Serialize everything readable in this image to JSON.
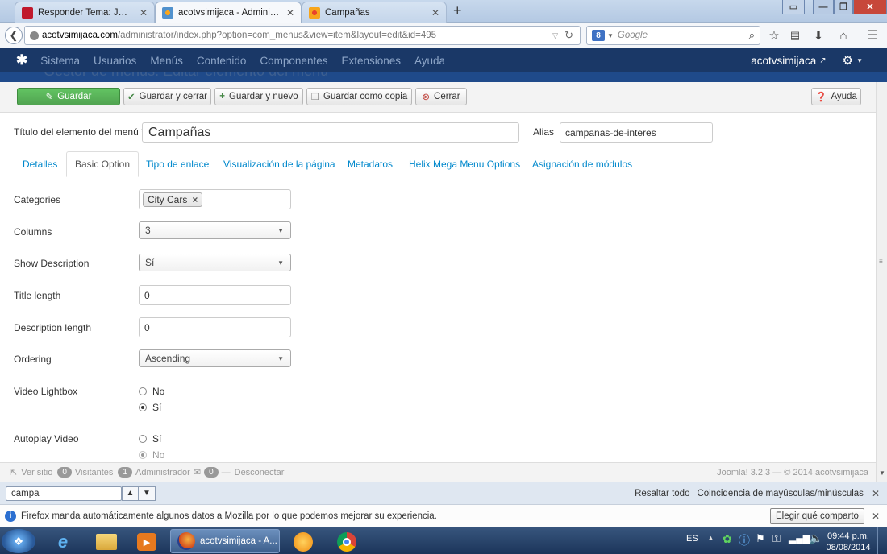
{
  "browser": {
    "tabs": [
      {
        "title": "Responder Tema: JM Video...",
        "icon": "wix-favicon",
        "active": false
      },
      {
        "title": "acotvsimijaca - Administra...",
        "icon": "joomla-favicon",
        "active": true
      },
      {
        "title": "Campañas",
        "icon": "joomla-favicon",
        "active": false
      }
    ],
    "new_tab": "+",
    "url_host": "acotvsimijaca.com",
    "url_path": "/administrator/index.php?option=com_menus&view=item&layout=edit&id=495",
    "search_placeholder": "Google"
  },
  "joomla": {
    "menu": [
      "Sistema",
      "Usuarios",
      "Menús",
      "Contenido",
      "Componentes",
      "Extensiones",
      "Ayuda"
    ],
    "site_name": "acotvsimijaca",
    "page_title": "Gestor de menús: Editar elemento del menú"
  },
  "toolbar": {
    "save": "Guardar",
    "save_close": "Guardar y cerrar",
    "save_new": "Guardar y nuevo",
    "save_copy": "Guardar como copia",
    "close": "Cerrar",
    "help": "Ayuda"
  },
  "form": {
    "title_label": "Título del elemento del menú *",
    "title_value": "Campañas",
    "alias_label": "Alias",
    "alias_value": "campanas-de-interes"
  },
  "tabs": [
    "Detalles",
    "Basic Option",
    "Tipo de enlace",
    "Visualización de la página",
    "Metadatos",
    "Helix Mega Menu Options",
    "Asignación de módulos"
  ],
  "fields": {
    "categories_label": "Categories",
    "categories_tag": "City Cars",
    "columns_label": "Columns",
    "columns_value": "3",
    "show_desc_label": "Show Description",
    "show_desc_value": "Sí",
    "title_length_label": "Title length",
    "title_length_value": "0",
    "desc_length_label": "Description length",
    "desc_length_value": "0",
    "ordering_label": "Ordering",
    "ordering_value": "Ascending",
    "video_lightbox_label": "Video Lightbox",
    "video_lightbox_no": "No",
    "video_lightbox_si": "Sí",
    "autoplay_label": "Autoplay Video",
    "autoplay_si": "Sí",
    "autoplay_no": "No"
  },
  "status": {
    "view_site": "Ver sitio",
    "visitors_count": "0",
    "visitors": "Visitantes",
    "admin_count": "1",
    "admin": "Administrador",
    "msg_count": "0",
    "logout": "Desconectar",
    "version": "Joomla! 3.2.3 — © 2014 acotvsimijaca"
  },
  "findbar": {
    "query": "campa",
    "highlight_all": "Resaltar todo",
    "match_case": "Coincidencia de mayúsculas/minúsculas"
  },
  "notification": {
    "text": "Firefox manda automáticamente algunos datos a Mozilla por lo que podemos mejorar su experiencia.",
    "button": "Elegir qué comparto"
  },
  "taskbar": {
    "active_window": "acotvsimijaca - A...",
    "lang": "ES",
    "time": "09:44 p.m.",
    "date": "08/08/2014"
  },
  "colors": {
    "joomla_nav": "#1a3867",
    "save_green": "#51a351",
    "link_blue": "#0088cc"
  }
}
